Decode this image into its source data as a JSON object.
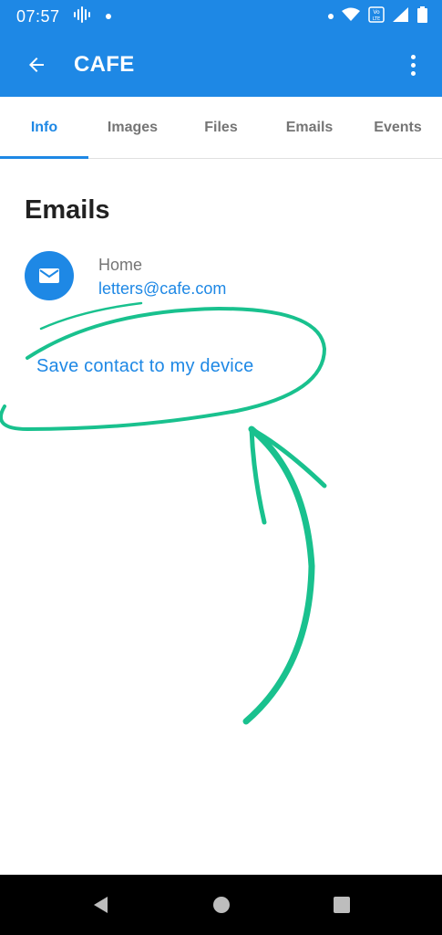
{
  "status_bar": {
    "time": "07:57",
    "icons": [
      "voice-wave-icon",
      "notification-dot-icon",
      "dot-icon",
      "wifi-icon",
      "volte-icon",
      "signal-icon",
      "battery-icon"
    ]
  },
  "app_bar": {
    "title": "CAFE",
    "back_icon": "arrow-left-icon",
    "menu_icon": "more-vertical-icon"
  },
  "tabs": [
    {
      "label": "Info",
      "active": true
    },
    {
      "label": "Images",
      "active": false
    },
    {
      "label": "Files",
      "active": false
    },
    {
      "label": "Emails",
      "active": false
    },
    {
      "label": "Events",
      "active": false
    }
  ],
  "emails_section": {
    "title": "Emails",
    "items": [
      {
        "label": "Home",
        "value": "letters@cafe.com",
        "icon": "mail-icon"
      }
    ]
  },
  "actions": {
    "save_contact": "Save contact to my device"
  },
  "colors": {
    "primary": "#1e88e5",
    "annotation": "#19c18e",
    "text_dark": "#212121",
    "text_muted": "#757575"
  },
  "nav_bar": {
    "back": "triangle-back-icon",
    "home": "circle-home-icon",
    "recents": "square-recents-icon"
  }
}
